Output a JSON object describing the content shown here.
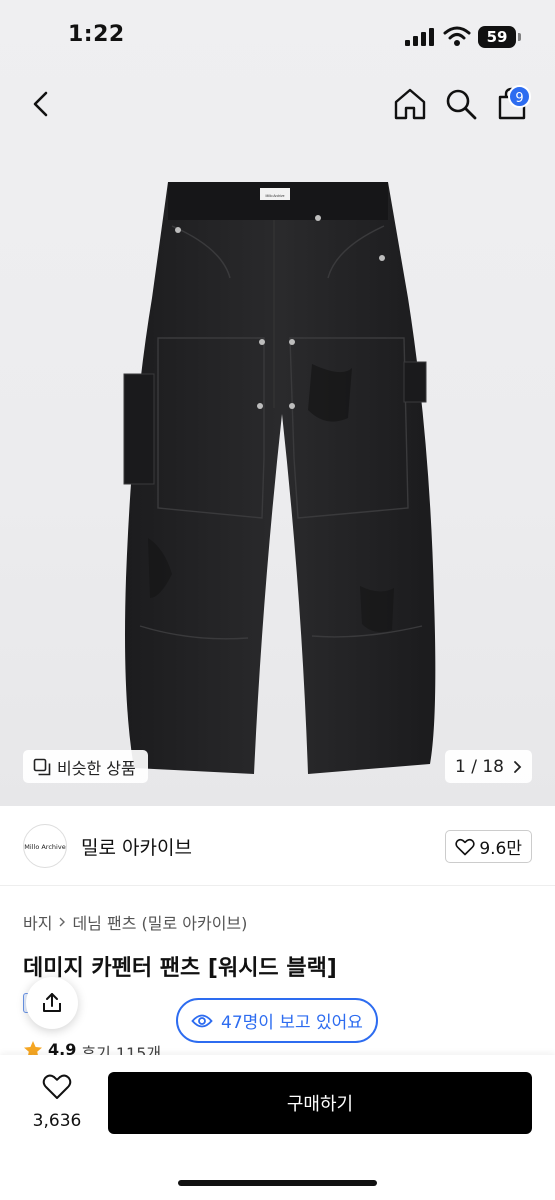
{
  "status_bar": {
    "time": "1:22",
    "battery": "59"
  },
  "nav": {
    "back_icon": "chevron-left-icon",
    "home_icon": "home-icon",
    "search_icon": "search-icon",
    "bag_icon": "shopping-bag-icon",
    "bag_badge": "9"
  },
  "gallery": {
    "similar_label": "비슷한 상품",
    "page_indicator": "1 / 18",
    "waistband_label": "Millo Archive"
  },
  "brand": {
    "logo_text": "Millo Archive",
    "name": "밀로 아카이브",
    "likes": "9.6만"
  },
  "breadcrumb": {
    "category": "바지",
    "subcategory": "데님 팬츠 (밀로 아카이브)"
  },
  "product": {
    "title": "데미지 카펜터 팬츠 [워시드 블랙]",
    "rating": "4.9",
    "review_label": "후기 115개"
  },
  "viewers": {
    "text": "47명이 보고 있어요"
  },
  "bottom_bar": {
    "wish_count": "3,636",
    "buy_label": "구매하기"
  },
  "colors": {
    "accent": "#2d6cf0",
    "buy_button": "#000000",
    "star": "#f5a623"
  }
}
